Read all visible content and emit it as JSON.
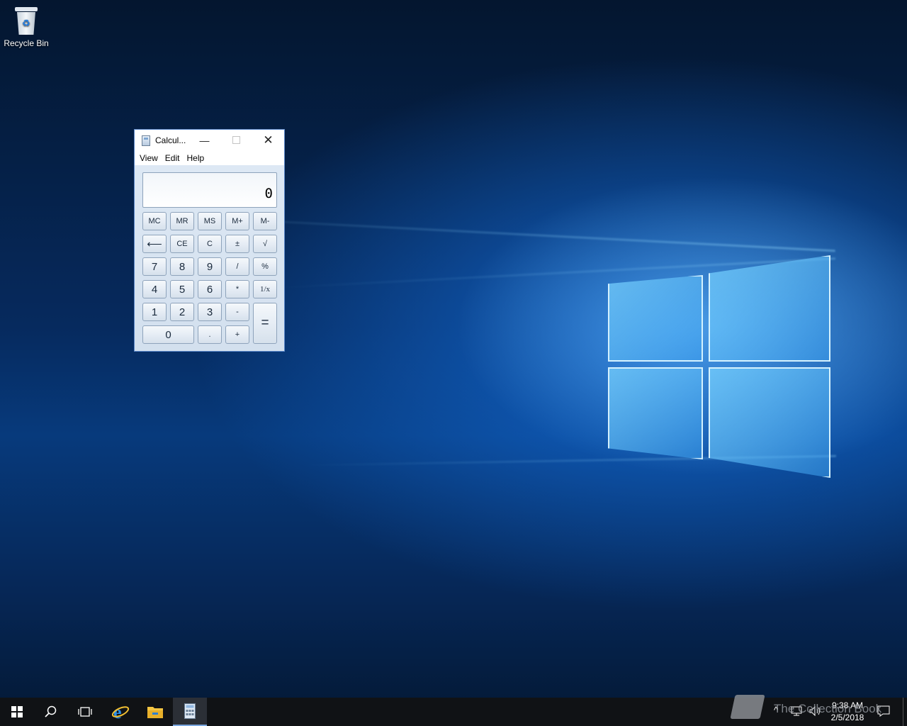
{
  "desktop": {
    "icons": [
      {
        "label": "Recycle Bin",
        "icon": "recycle-bin-icon"
      }
    ]
  },
  "calculator": {
    "title": "Calcul...",
    "menu": [
      "View",
      "Edit",
      "Help"
    ],
    "display_value": "0",
    "memory_row": [
      "MC",
      "MR",
      "MS",
      "M+",
      "M-"
    ],
    "row2": [
      "⟵",
      "CE",
      "C",
      "±",
      "√"
    ],
    "row3": [
      "7",
      "8",
      "9",
      "/",
      "%"
    ],
    "row4": [
      "4",
      "5",
      "6",
      "*",
      "1/x"
    ],
    "row5": [
      "1",
      "2",
      "3",
      "-"
    ],
    "row6": [
      "0",
      ".",
      "+"
    ],
    "equals": "="
  },
  "taskbar": {
    "items": [
      "start-icon",
      "search-icon",
      "task-view-icon",
      "internet-explorer-icon",
      "file-explorer-icon",
      "calculator-icon"
    ],
    "clock_time": "9:38 AM",
    "clock_date": "2/5/2018",
    "watermark": "The Collection Book"
  }
}
